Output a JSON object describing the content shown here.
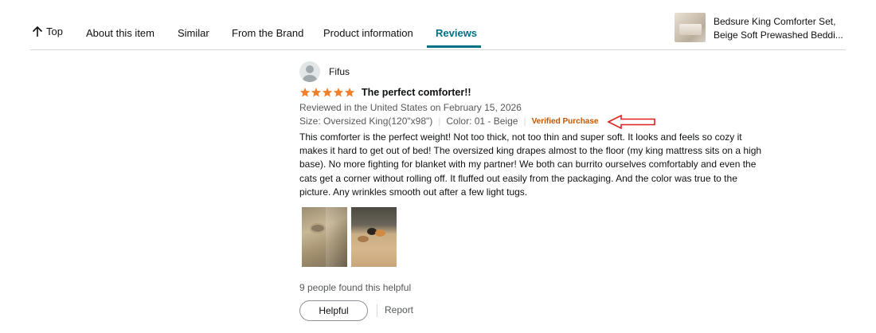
{
  "nav": {
    "tabs": [
      {
        "label": "Top"
      },
      {
        "label": "About this item"
      },
      {
        "label": "Similar"
      },
      {
        "label": "From the Brand"
      },
      {
        "label": "Product information"
      },
      {
        "label": "Reviews"
      }
    ],
    "active_tab": "Reviews",
    "product": {
      "title_line1": "Bedsure King Comforter Set,",
      "title_line2": "Beige Soft Prewashed Beddi..."
    }
  },
  "review": {
    "reviewer_name": "Fifus",
    "rating": 5,
    "rating_max": 5,
    "title": "The perfect comforter!!",
    "date_line": "Reviewed in the United States on February 15, 2026",
    "size": "Size: Oversized King(120\"x98\")",
    "color": "Color: 01 - Beige",
    "verified": "Verified Purchase",
    "body": "This comforter is the perfect weight! Not too thick, not too thin and super soft. It looks and feels so cozy it makes it hard to get out of bed! The oversized king drapes almost to the floor (my king mattress sits on a high base). No more fighting for blanket with my partner! We both can burrito ourselves comfortably and even the cats get a corner without rolling off. It fluffed out easily from the packaging. And the color was true to the picture. Any wrinkles smooth out after a few light tugs.",
    "helpful_count": "9 people found this helpful",
    "helpful_label": "Helpful",
    "report_label": "Report"
  },
  "colors": {
    "accent": "#007185",
    "star": "#f1802a",
    "verified": "#c45500",
    "annotation_arrow": "#e02020"
  },
  "icons": [
    "arrow-up-icon",
    "avatar-icon",
    "star-icon",
    "annotation-arrow"
  ]
}
